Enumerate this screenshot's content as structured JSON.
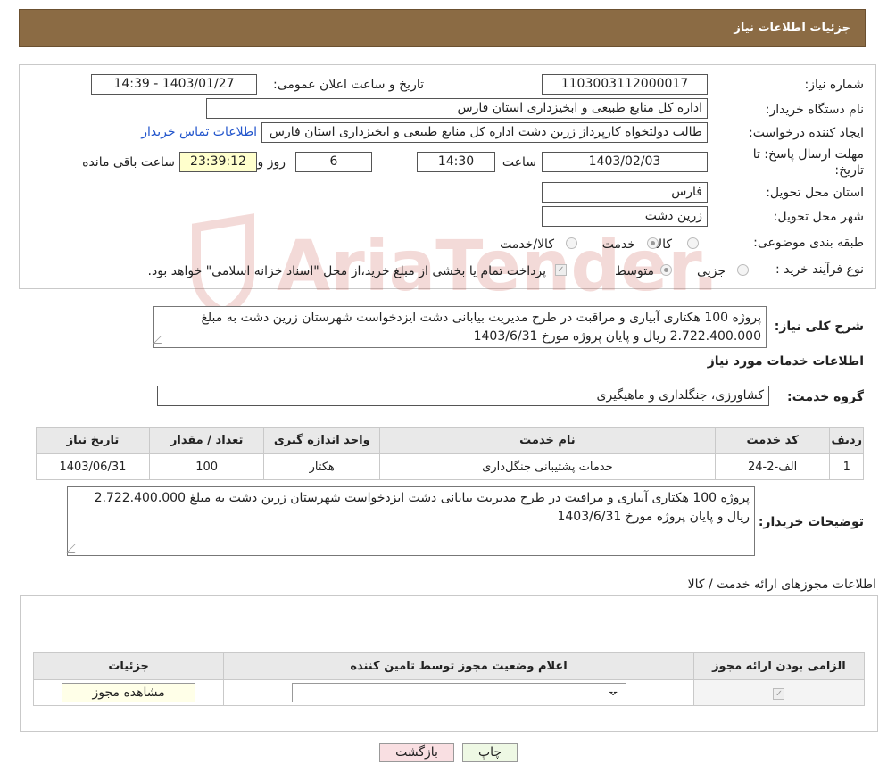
{
  "header": {
    "title": "جزئیات اطلاعات نیاز"
  },
  "watermark": {
    "text": "AriaTender.neT",
    "color": "#c0392b"
  },
  "form": {
    "need_number_label": "شماره نیاز:",
    "need_number": "1103003112000017",
    "announce_label": "تاریخ و ساعت اعلان عمومی:",
    "announce_value": "1403/01/27 - 14:39",
    "buyer_org_label": "نام دستگاه خریدار:",
    "buyer_org": "اداره کل منابع طبیعی و ابخیزداری استان فارس",
    "creator_label": "ایجاد کننده درخواست:",
    "creator": "طالب دولتخواه کارپرداز زرین دشت اداره کل منابع طبیعی و ابخیزداری استان فارس",
    "contact_link": "اطلاعات تماس خریدار",
    "deadline_label_1": "مهلت ارسال پاسخ: تا",
    "deadline_label_2": "تاریخ:",
    "deadline_date": "1403/02/03",
    "time_label": "ساعت",
    "deadline_time": "14:30",
    "days_value": "6",
    "days_label": "روز و",
    "remaining_time": "23:39:12",
    "remaining_label": "ساعت باقی مانده",
    "province_label": "استان محل تحویل:",
    "province": "فارس",
    "city_label": "شهر محل تحویل:",
    "city": "زرین دشت",
    "category_label": "طبقه بندی موضوعی:",
    "category_options": [
      "کالا",
      "خدمت",
      "کالا/خدمت"
    ],
    "category_selected": "خدمت",
    "process_label": "نوع فرآیند خرید :",
    "process_options": [
      "جزیی",
      "متوسط"
    ],
    "payment_note": "پرداخت تمام یا بخشی از مبلغ خرید،از محل \"اسناد خزانه اسلامی\" خواهد بود."
  },
  "description": {
    "label": "شرح کلی نیاز:",
    "text": "پروژه 100 هکتاری آبیاری و مراقبت در طرح مدیریت بیابانی دشت ایزدخواست شهرستان زرین دشت به مبلغ 2.722.400.000 ریال و پایان پروژه مورخ 1403/6/31"
  },
  "services": {
    "title": "اطلاعات خدمات مورد نیاز",
    "group_label": "گروه خدمت:",
    "group_value": "کشاورزی، جنگلداری و ماهیگیری",
    "columns": [
      "ردیف",
      "کد خدمت",
      "نام خدمت",
      "واحد اندازه گیری",
      "تعداد / مقدار",
      "تاریخ نیاز"
    ],
    "rows": [
      [
        "1",
        "الف-2-24",
        "خدمات پشتیبانی جنگل‌داری",
        "هکتار",
        "100",
        "1403/06/31"
      ]
    ]
  },
  "buyer_notes": {
    "label": "توضیحات خریدار:",
    "text": "پروژه 100 هکتاری آبیاری و مراقبت در طرح مدیریت بیابانی دشت ایزدخواست شهرستان زرین دشت به مبلغ 2.722.400.000 ریال و پایان پروژه مورخ 1403/6/31"
  },
  "permits": {
    "title": "اطلاعات مجوزهای ارائه خدمت / کالا",
    "columns": [
      "الزامی بودن ارائه مجوز",
      "اعلام وضعیت مجوز توسط تامین کننده",
      "جزئیات"
    ],
    "select_value": "--",
    "view_button": "مشاهده مجوز"
  },
  "footer": {
    "print_button": "چاپ",
    "back_button": "بازگشت"
  }
}
